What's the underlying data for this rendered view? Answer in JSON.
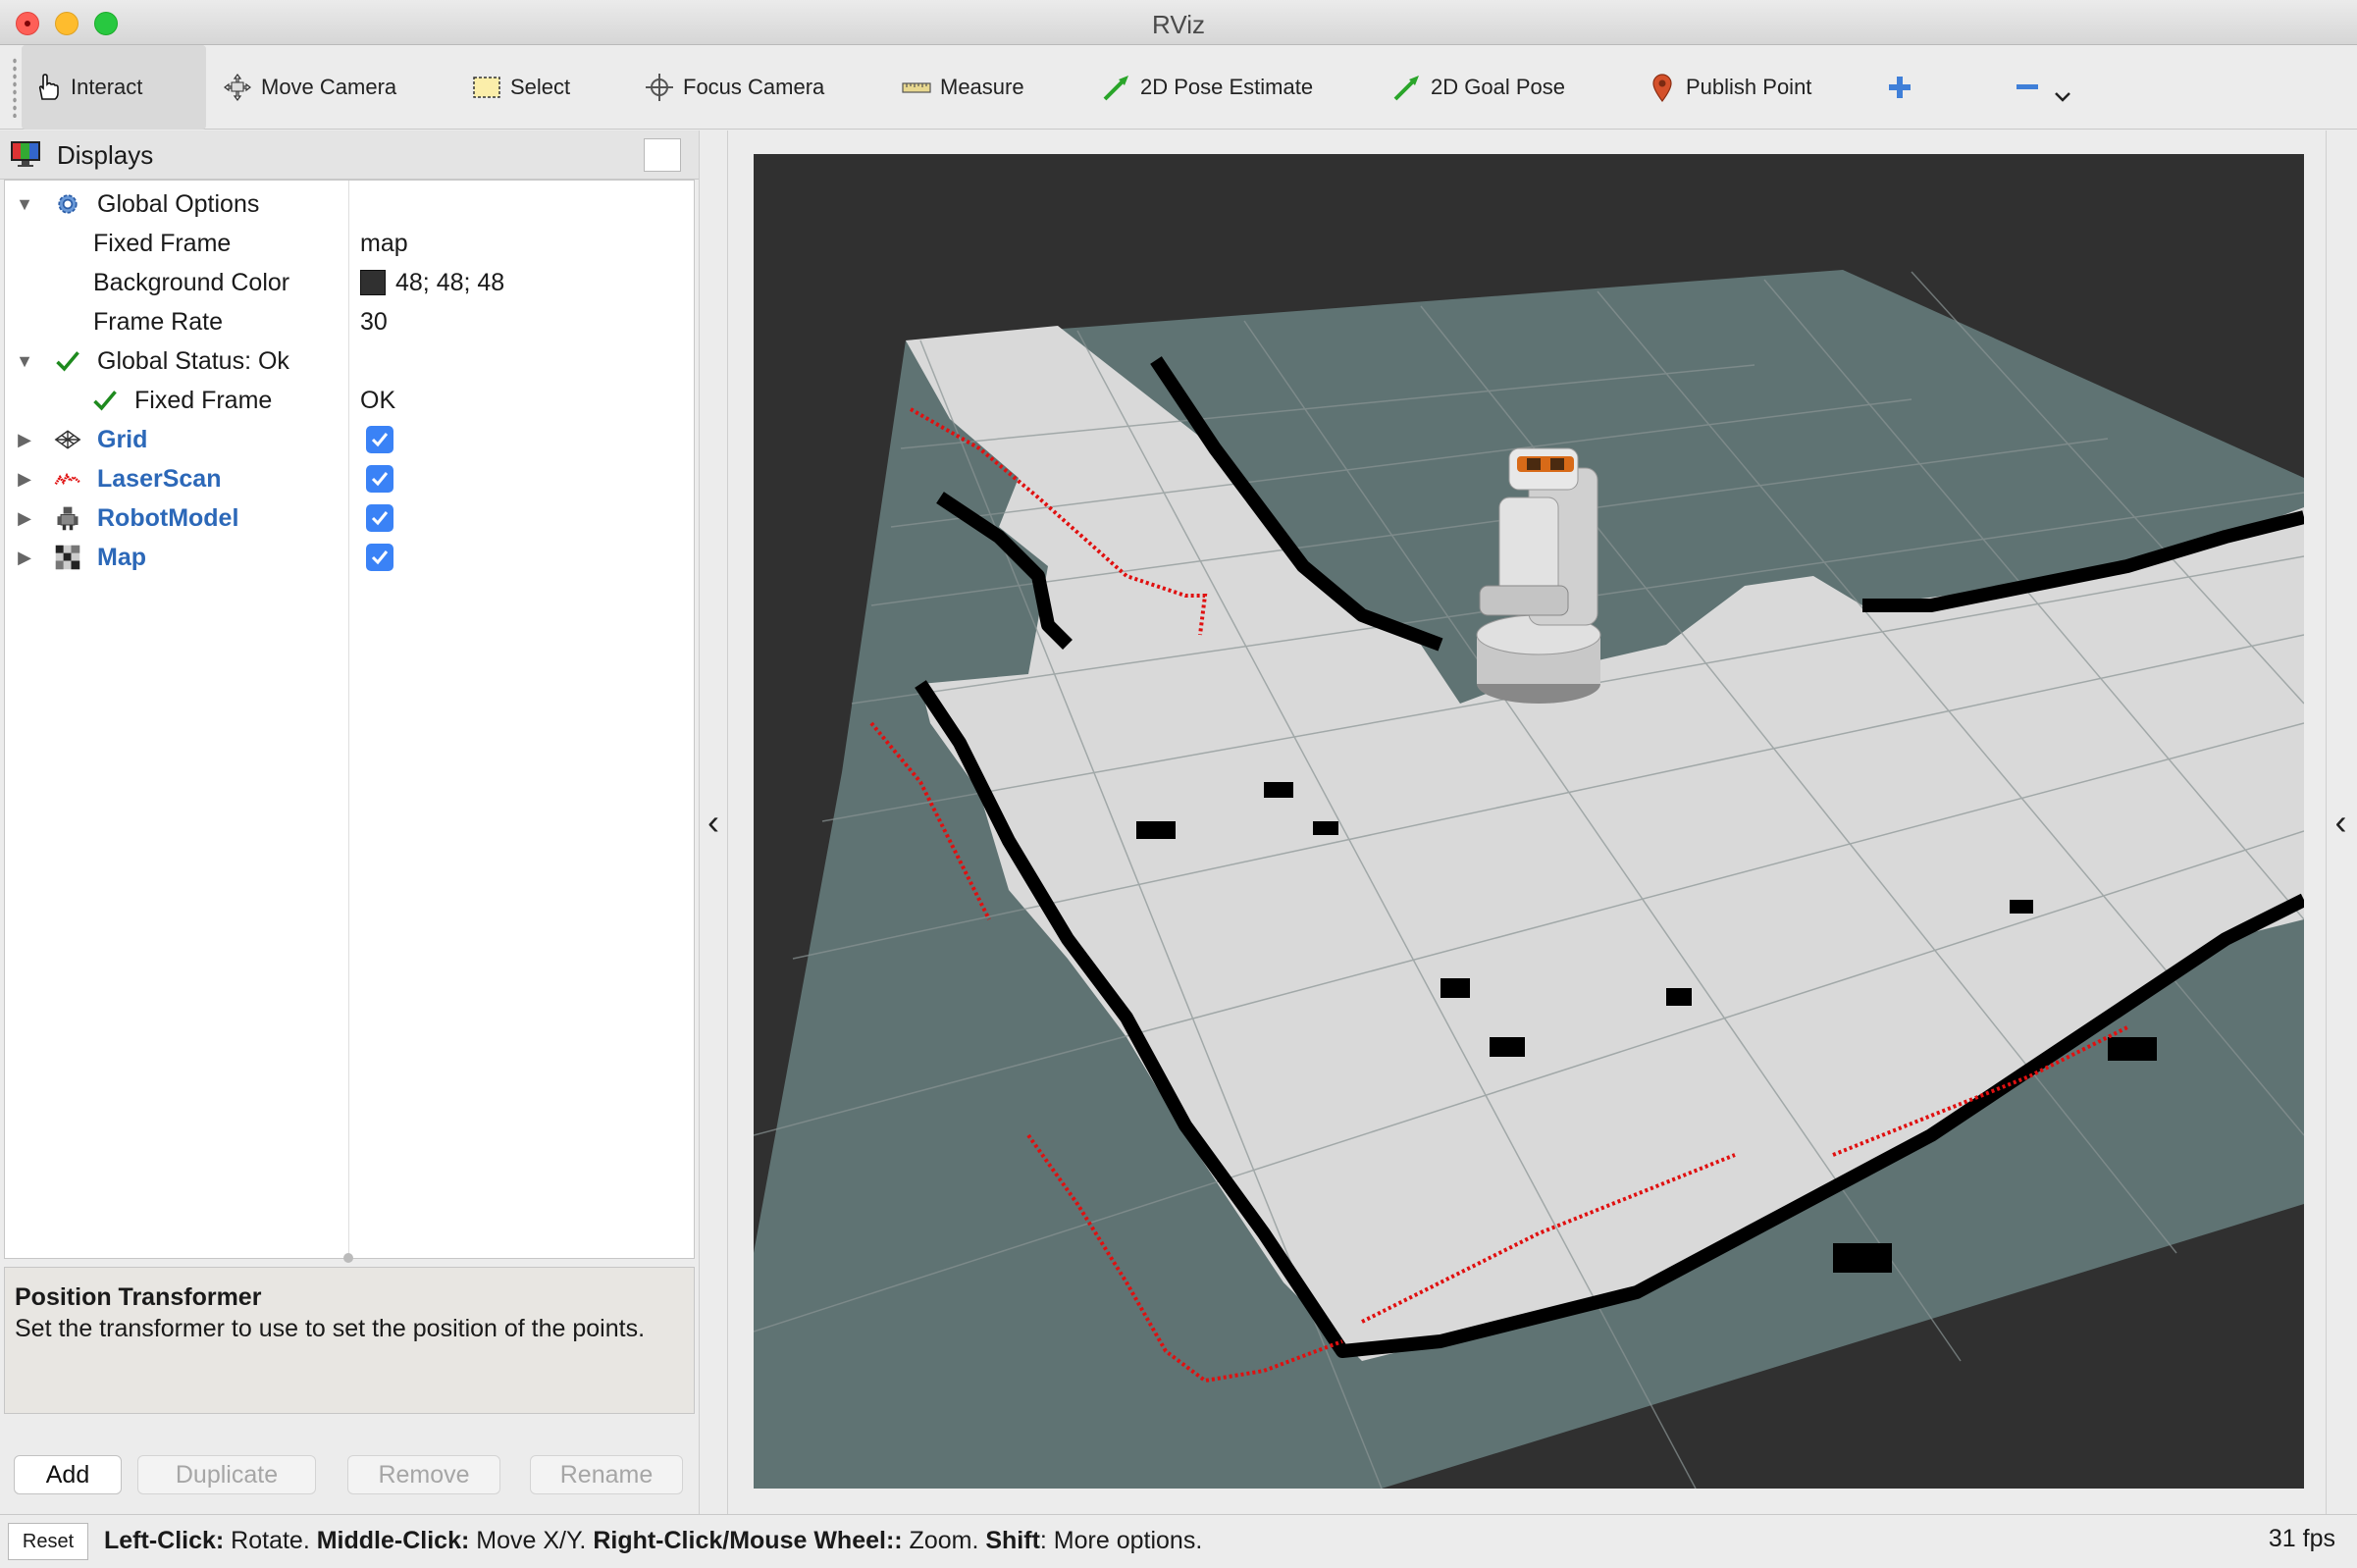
{
  "window": {
    "title": "RViz"
  },
  "toolbar": {
    "tools": [
      {
        "label": "Interact",
        "icon": "hand-pointer-icon"
      },
      {
        "label": "Move Camera",
        "icon": "move-camera-icon"
      },
      {
        "label": "Select",
        "icon": "select-rect-icon"
      },
      {
        "label": "Focus Camera",
        "icon": "focus-camera-icon"
      },
      {
        "label": "Measure",
        "icon": "ruler-icon"
      },
      {
        "label": "2D Pose Estimate",
        "icon": "green-arrow-icon"
      },
      {
        "label": "2D Goal Pose",
        "icon": "green-arrow-icon"
      },
      {
        "label": "Publish Point",
        "icon": "map-pin-icon"
      }
    ],
    "add_tool_icon": "plus-icon",
    "remove_tool_icon": "minus-icon",
    "overflow_icon": "chevron-down-icon"
  },
  "displays": {
    "title": "Displays",
    "tree": {
      "global_options": {
        "label": "Global Options",
        "fixed_frame_label": "Fixed Frame",
        "fixed_frame_value": "map",
        "background_color_label": "Background Color",
        "background_color_value": "48; 48; 48",
        "background_color_hex": "#303030",
        "frame_rate_label": "Frame Rate",
        "frame_rate_value": "30"
      },
      "global_status": {
        "label": "Global Status: Ok",
        "fixed_frame_label": "Fixed Frame",
        "fixed_frame_value": "OK"
      },
      "items": [
        {
          "label": "Grid",
          "checked": true,
          "icon": "grid-icon"
        },
        {
          "label": "LaserScan",
          "checked": true,
          "icon": "laserscan-icon"
        },
        {
          "label": "RobotModel",
          "checked": true,
          "icon": "robot-icon"
        },
        {
          "label": "Map",
          "checked": true,
          "icon": "map-icon"
        }
      ]
    },
    "description": {
      "title": "Position Transformer",
      "text": "Set the transformer to use to set the position of the points."
    },
    "buttons": {
      "add": "Add",
      "duplicate": "Duplicate",
      "remove": "Remove",
      "rename": "Rename"
    }
  },
  "statusbar": {
    "reset": "Reset",
    "hint_parts": [
      {
        "bold": "Left-Click:",
        "text": " Rotate. "
      },
      {
        "bold": "Middle-Click:",
        "text": " Move X/Y. "
      },
      {
        "bold": "Right-Click/Mouse Wheel::",
        "text": " Zoom. "
      },
      {
        "bold": "Shift",
        "text": ": More options."
      }
    ],
    "fps": "31 fps"
  },
  "colors": {
    "accent_blue": "#2c68b8",
    "checkbox_blue": "#3a82f6",
    "laser_red": "#e01010",
    "status_green": "#1e8a1e",
    "map_free": "#d9d9d9",
    "map_unknown": "#5f7373",
    "map_occupied": "#000000"
  }
}
